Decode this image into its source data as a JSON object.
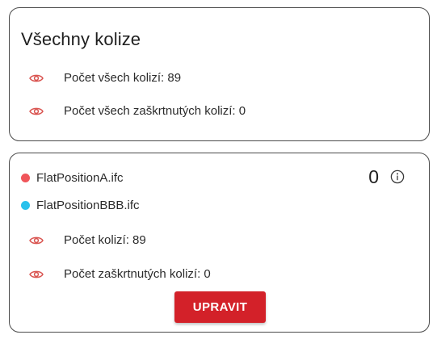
{
  "all_collisions": {
    "title": "Všechny kolize",
    "rows": [
      {
        "label": "Počet všech kolizí: 89",
        "icon": "eye-icon"
      },
      {
        "label": "Počet všech zaškrtnutých kolizí: 0",
        "icon": "eye-icon"
      }
    ]
  },
  "pair": {
    "files": [
      {
        "name": "FlatPositionA.ifc",
        "color": "#f0555a"
      },
      {
        "name": "FlatPositionBBB.ifc",
        "color": "#29c1ec"
      }
    ],
    "count": "0",
    "info_icon": "info-circle-icon",
    "rows": [
      {
        "label": "Počet kolizí: 89",
        "icon": "eye-icon"
      },
      {
        "label": "Počet zaškrtnutých kolizí: 0",
        "icon": "eye-icon"
      }
    ],
    "button_label": "UPRAVIT"
  },
  "colors": {
    "eye_icon": "#d9534f",
    "button": "#d32129"
  }
}
